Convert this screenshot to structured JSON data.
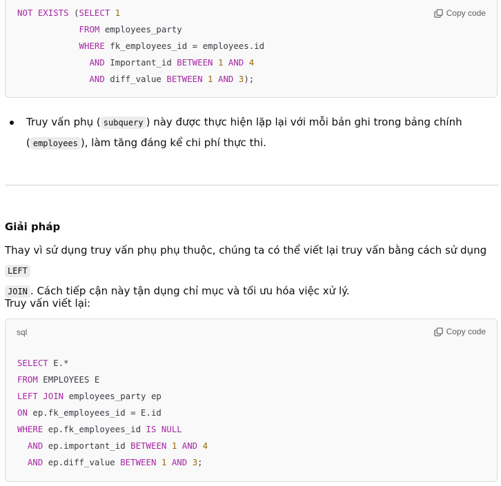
{
  "copy_label": "Copy code",
  "code_block_1": {
    "lines": [
      [
        {
          "t": "NOT EXISTS",
          "k": "kw"
        },
        {
          "t": " ("
        },
        {
          "t": "SELECT",
          "k": "kw"
        },
        {
          "t": " "
        },
        {
          "t": "1",
          "k": "num"
        }
      ],
      [
        {
          "t": "            "
        },
        {
          "t": "FROM",
          "k": "kw"
        },
        {
          "t": " employees_party"
        }
      ],
      [
        {
          "t": "            "
        },
        {
          "t": "WHERE",
          "k": "kw"
        },
        {
          "t": " fk_employees_id = employees.id"
        }
      ],
      [
        {
          "t": "              "
        },
        {
          "t": "AND",
          "k": "kw"
        },
        {
          "t": " Important_id "
        },
        {
          "t": "BETWEEN",
          "k": "kw"
        },
        {
          "t": " "
        },
        {
          "t": "1",
          "k": "num"
        },
        {
          "t": " "
        },
        {
          "t": "AND",
          "k": "kw"
        },
        {
          "t": " "
        },
        {
          "t": "4",
          "k": "num"
        }
      ],
      [
        {
          "t": "              "
        },
        {
          "t": "AND",
          "k": "kw"
        },
        {
          "t": " diff_value "
        },
        {
          "t": "BETWEEN",
          "k": "kw"
        },
        {
          "t": " "
        },
        {
          "t": "1",
          "k": "num"
        },
        {
          "t": " "
        },
        {
          "t": "AND",
          "k": "kw"
        },
        {
          "t": " "
        },
        {
          "t": "3",
          "k": "num"
        },
        {
          "t": ");"
        }
      ]
    ]
  },
  "bullet": {
    "line1_pre": "Truy vấn phụ (",
    "line1_code": "subquery",
    "line1_post": ") này được thực hiện lặp lại với mỗi bản ghi trong bảng chính",
    "line2_pre": "(",
    "line2_code": "employees",
    "line2_post": "), làm tăng đáng kể chi phí thực thi."
  },
  "solution": {
    "heading": "Giải pháp",
    "para_line1_pre": "Thay vì sử dụng truy vấn phụ phụ thuộc, chúng ta có thể viết lại truy vấn bằng cách sử dụng ",
    "para_code_a": "LEFT",
    "para_code_b": "JOIN",
    "para_line2_post": ". Cách tiếp cận này tận dụng chỉ mục và tối ưu hóa việc xử lý.",
    "rewritten_label": "Truy vấn viết lại:"
  },
  "code_block_2": {
    "language": "sql",
    "lines": [
      [
        {
          "t": "SELECT",
          "k": "kw"
        },
        {
          "t": " E.*"
        }
      ],
      [
        {
          "t": "FROM",
          "k": "kw"
        },
        {
          "t": " EMPLOYEES E"
        }
      ],
      [
        {
          "t": "LEFT JOIN",
          "k": "kw"
        },
        {
          "t": " employees_party ep"
        }
      ],
      [
        {
          "t": "ON",
          "k": "kw"
        },
        {
          "t": " ep.fk_employees_id = E.id"
        }
      ],
      [
        {
          "t": "WHERE",
          "k": "kw"
        },
        {
          "t": " ep.fk_employees_id "
        },
        {
          "t": "IS NULL",
          "k": "kw"
        }
      ],
      [
        {
          "t": "  "
        },
        {
          "t": "AND",
          "k": "kw"
        },
        {
          "t": " ep.important_id "
        },
        {
          "t": "BETWEEN",
          "k": "kw"
        },
        {
          "t": " "
        },
        {
          "t": "1",
          "k": "num"
        },
        {
          "t": " "
        },
        {
          "t": "AND",
          "k": "kw"
        },
        {
          "t": " "
        },
        {
          "t": "4",
          "k": "num"
        }
      ],
      [
        {
          "t": "  "
        },
        {
          "t": "AND",
          "k": "kw"
        },
        {
          "t": " ep.diff_value "
        },
        {
          "t": "BETWEEN",
          "k": "kw"
        },
        {
          "t": " "
        },
        {
          "t": "1",
          "k": "num"
        },
        {
          "t": " "
        },
        {
          "t": "AND",
          "k": "kw"
        },
        {
          "t": " "
        },
        {
          "t": "3",
          "k": "num"
        },
        {
          "t": ";"
        }
      ]
    ]
  },
  "colors": {
    "keyword": "#a626a4",
    "number": "#986801",
    "plain": "#383a42"
  },
  "icons": {
    "copy": "copy-icon"
  }
}
